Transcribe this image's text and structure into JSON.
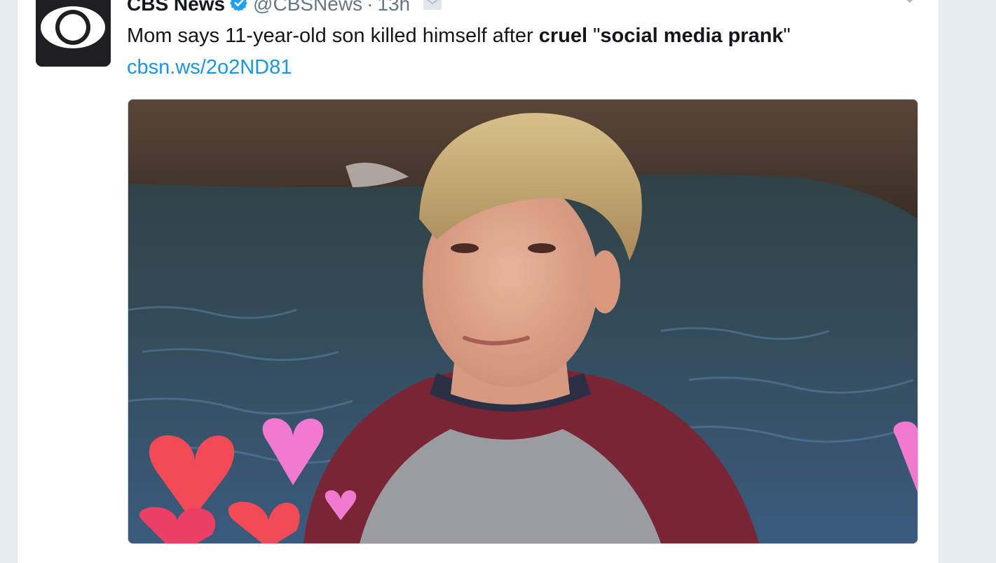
{
  "tweet": {
    "display_name": "CBS News",
    "handle": "@CBSNews",
    "separator": "·",
    "time": "13h",
    "text_prefix": "Mom says 11-year-old son killed himself after ",
    "text_bold_1": "cruel",
    "text_mid": " \"",
    "text_bold_2": "social media prank",
    "text_suffix": "\"",
    "link": "cbsn.ws/2o2ND81"
  },
  "icons": {
    "avatar": "cbs-eye-logo",
    "verified": "verified-badge-icon",
    "dm": "envelope-icon",
    "menu": "chevron-down-icon"
  },
  "colors": {
    "background": "#e6ecf0",
    "text": "#14171a",
    "secondary": "#657786",
    "link": "#1b95e0",
    "verified": "#1da1f2"
  }
}
